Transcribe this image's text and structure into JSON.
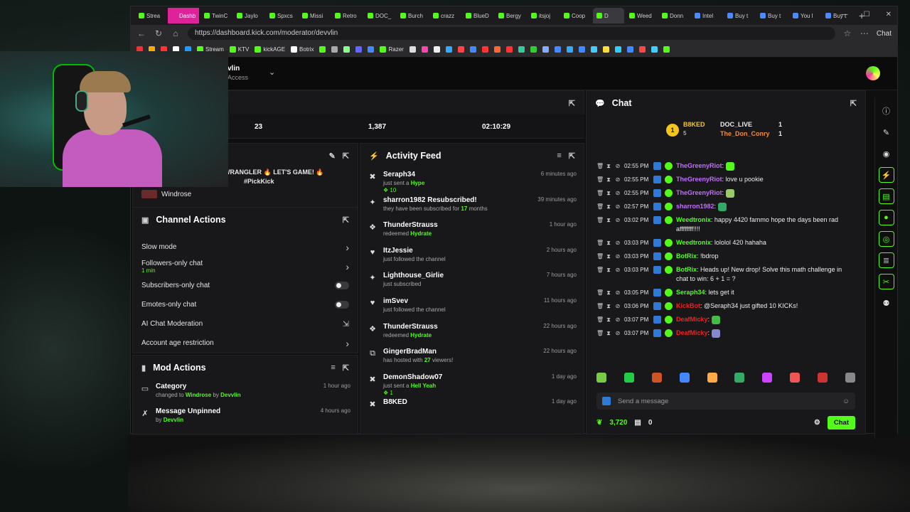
{
  "tabs": [
    {
      "label": "Strea",
      "color": "#53fc18"
    },
    {
      "label": "Dashb",
      "color": "#e0229a",
      "pink": true
    },
    {
      "label": "TwinC",
      "color": "#53fc18"
    },
    {
      "label": "Jaylo",
      "color": "#53fc18"
    },
    {
      "label": "Spxcs",
      "color": "#53fc18"
    },
    {
      "label": "Missi",
      "color": "#53fc18"
    },
    {
      "label": "Retro",
      "color": "#53fc18"
    },
    {
      "label": "DOC_",
      "color": "#53fc18"
    },
    {
      "label": "Burch",
      "color": "#53fc18"
    },
    {
      "label": "crazz",
      "color": "#53fc18"
    },
    {
      "label": "BlueD",
      "color": "#53fc18"
    },
    {
      "label": "Bergy",
      "color": "#53fc18"
    },
    {
      "label": "itsjoj",
      "color": "#53fc18"
    },
    {
      "label": "Coop",
      "color": "#53fc18"
    },
    {
      "label": "D",
      "color": "#53fc18",
      "active": true
    },
    {
      "label": "Weed",
      "color": "#53fc18"
    },
    {
      "label": "Donn",
      "color": "#53fc18"
    },
    {
      "label": "Intel",
      "color": "#4a8cff"
    },
    {
      "label": "Buy t",
      "color": "#4a8cff"
    },
    {
      "label": "Buy t",
      "color": "#4a8cff"
    },
    {
      "label": "You l",
      "color": "#4a8cff"
    },
    {
      "label": "Buy t",
      "color": "#4a8cff"
    }
  ],
  "url": "https://dashboard.kick.com/moderator/devvlin",
  "browser_chat": "Chat",
  "bookmarks": [
    {
      "label": "",
      "color": "#e33"
    },
    {
      "label": "",
      "color": "#fa0"
    },
    {
      "label": "",
      "color": "#f33"
    },
    {
      "label": "",
      "color": "#fff"
    },
    {
      "label": "",
      "color": "#29f"
    },
    {
      "label": "Stream",
      "color": "#53fc18"
    },
    {
      "label": "KTV",
      "color": "#53fc18"
    },
    {
      "label": "kickAGE",
      "color": "#53fc18"
    },
    {
      "label": "Botrix",
      "color": "#fff"
    },
    {
      "label": "",
      "color": "#53fc18"
    },
    {
      "label": "",
      "color": "#aaa"
    },
    {
      "label": "",
      "color": "#8f8"
    },
    {
      "label": "",
      "color": "#66f"
    },
    {
      "label": "",
      "color": "#48f"
    },
    {
      "label": "Razer",
      "color": "#53fc18"
    },
    {
      "label": "",
      "color": "#ddd"
    },
    {
      "label": "",
      "color": "#f4a"
    },
    {
      "label": "",
      "color": "#eee"
    },
    {
      "label": "",
      "color": "#3af"
    },
    {
      "label": "",
      "color": "#f44"
    },
    {
      "label": "",
      "color": "#48f"
    },
    {
      "label": "",
      "color": "#f33"
    },
    {
      "label": "",
      "color": "#f63"
    },
    {
      "label": "",
      "color": "#f33"
    },
    {
      "label": "",
      "color": "#3c9"
    },
    {
      "label": "",
      "color": "#3c3"
    },
    {
      "label": "",
      "color": "#8af"
    },
    {
      "label": "",
      "color": "#48f"
    },
    {
      "label": "",
      "color": "#3af"
    },
    {
      "label": "",
      "color": "#48f"
    },
    {
      "label": "",
      "color": "#4cf"
    },
    {
      "label": "",
      "color": "#fd3"
    },
    {
      "label": "",
      "color": "#3cf"
    },
    {
      "label": "",
      "color": "#48f"
    },
    {
      "label": "",
      "color": "#f44"
    },
    {
      "label": "",
      "color": "#4cf"
    },
    {
      "label": "",
      "color": "#53fc18"
    }
  ],
  "header": {
    "channel": "vlin",
    "access": "Access"
  },
  "stats": [
    "23",
    "1,387",
    "02:10:29"
  ],
  "stream_info": {
    "title": "AOS WRANGLER 🔥 LET'S GAME! 🔥",
    "title2": "#PickKick",
    "category": "Windrose"
  },
  "channel_actions": {
    "title": "Channel Actions",
    "items": [
      {
        "label": "Slow mode",
        "sub": "",
        "control": "chevron"
      },
      {
        "label": "Followers-only chat",
        "sub": "1 min",
        "control": "chevron"
      },
      {
        "label": "Subscribers-only chat",
        "sub": "",
        "control": "toggle"
      },
      {
        "label": "Emotes-only chat",
        "sub": "",
        "control": "toggle"
      },
      {
        "label": "AI Chat Moderation",
        "sub": "",
        "control": "external"
      },
      {
        "label": "Account age restriction",
        "sub": "",
        "control": "chevron"
      }
    ]
  },
  "mod_actions": {
    "title": "Mod Actions",
    "items": [
      {
        "icon": "category-icon",
        "title": "Category",
        "desc": "changed to",
        "highlight": "Windrose",
        "by": "by",
        "user": "Devvlin",
        "time": "1 hour ago"
      },
      {
        "icon": "unpin-icon",
        "title": "Message Unpinned",
        "desc": "",
        "highlight": "",
        "by": "by",
        "user": "Devvlin",
        "time": "4 hours ago"
      }
    ]
  },
  "activity": {
    "title": "Activity Feed",
    "items": [
      {
        "icon": "hype-icon",
        "glyph": "✖",
        "name": "Seraph34",
        "desc": "just sent a",
        "hl": "Hype",
        "tag": "10",
        "time": "6 minutes ago"
      },
      {
        "icon": "sparkle-icon",
        "glyph": "✦",
        "name": "sharron1982 Resubscribed!",
        "desc": "they have been subscribed for",
        "hl": "17",
        "tail": "months",
        "tag": "",
        "time": "39 minutes ago"
      },
      {
        "icon": "redeem-icon",
        "glyph": "❖",
        "name": "ThunderStrauss",
        "desc": "redeemed",
        "hl": "Hydrate",
        "tag": "",
        "time": "1 hour ago"
      },
      {
        "icon": "heart-icon",
        "glyph": "♥",
        "name": "ItzJessie",
        "desc": "just followed the channel",
        "hl": "",
        "tag": "",
        "time": "2 hours ago"
      },
      {
        "icon": "sparkle-icon",
        "glyph": "✦",
        "name": "Lighthouse_Girlie",
        "desc": "just subscribed",
        "hl": "",
        "tag": "",
        "time": "7 hours ago"
      },
      {
        "icon": "heart-icon",
        "glyph": "♥",
        "name": "imSvev",
        "desc": "just followed the channel",
        "hl": "",
        "tag": "",
        "time": "11 hours ago"
      },
      {
        "icon": "redeem-icon",
        "glyph": "❖",
        "name": "ThunderStrauss",
        "desc": "redeemed",
        "hl": "Hydrate",
        "tag": "",
        "time": "22 hours ago"
      },
      {
        "icon": "host-icon",
        "glyph": "⧉",
        "name": "GingerBradMan",
        "desc": "has hosted with",
        "hl": "27",
        "tail": "viewers!",
        "tag": "",
        "time": "22 hours ago"
      },
      {
        "icon": "hype-icon",
        "glyph": "✖",
        "name": "DemonShadow07",
        "desc": "just sent a",
        "hl": "Hell Yeah",
        "tag": "1",
        "time": "1 day ago"
      },
      {
        "icon": "hype-icon",
        "glyph": "✖",
        "name": "B8KED",
        "desc": "",
        "hl": "",
        "tag": "",
        "time": "1 day ago"
      }
    ]
  },
  "chat": {
    "title": "Chat",
    "leaderboard": [
      {
        "rank": "1",
        "name": "B8KED",
        "count": "5"
      },
      {
        "name": "DOC_LIVE",
        "count": "1"
      },
      {
        "name": "The_Don_Conry",
        "count": "1"
      }
    ],
    "messages": [
      {
        "time": "02:55 PM",
        "user": "TheGreenyRiot",
        "ucolor": "#c36cff",
        "text": "",
        "emote": "#53fc18"
      },
      {
        "time": "02:55 PM",
        "user": "TheGreenyRiot",
        "ucolor": "#c36cff",
        "text": "love u pookie",
        "emote": ""
      },
      {
        "time": "02:55 PM",
        "user": "TheGreenyRiot",
        "ucolor": "#c36cff",
        "text": "",
        "emote": "#9c6"
      },
      {
        "time": "02:57 PM",
        "user": "sharron1982",
        "ucolor": "#c36cff",
        "text": "",
        "emote": "#3a6"
      },
      {
        "time": "03:02 PM",
        "user": "Weedtronix",
        "ucolor": "#53fc18",
        "text": "happy 4420 fammo hope the days been rad affffffff!!!!",
        "emote": ""
      },
      {
        "time": "03:03 PM",
        "user": "Weedtronix",
        "ucolor": "#53fc18",
        "text": "lololol 420 hahaha",
        "emote": ""
      },
      {
        "time": "03:03 PM",
        "user": "BotRix",
        "ucolor": "#53fc18",
        "text": "!bdrop",
        "emote": ""
      },
      {
        "time": "03:03 PM",
        "user": "BotRix",
        "ucolor": "#53fc18",
        "text": "Heads up! New drop! Solve this math challenge in chat to win: 6 + 1 = ?",
        "emote": ""
      },
      {
        "time": "03:05 PM",
        "user": "Seraph34",
        "ucolor": "#53fc18",
        "text": "lets get it",
        "emote": ""
      },
      {
        "time": "03:06 PM",
        "user": "KickBot",
        "ucolor": "#e22",
        "text": "@Seraph34 just gifted 10 KICKs!",
        "emote": ""
      },
      {
        "time": "03:07 PM",
        "user": "DeafMicky",
        "ucolor": "#e22",
        "text": "",
        "emote": "#4b4"
      },
      {
        "time": "03:07 PM",
        "user": "DeafMicky",
        "ucolor": "#e22",
        "text": "",
        "emote": "#88c"
      }
    ],
    "placeholder": "Send a message",
    "points": "3,720",
    "drops": "0",
    "send_label": "Chat"
  }
}
